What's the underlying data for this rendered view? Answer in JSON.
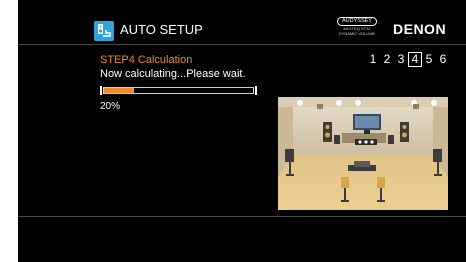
{
  "header": {
    "title": "AUTO SETUP",
    "brand": "DENON",
    "audyssey": {
      "badge": "AUDYSSEY",
      "line1": "MULTEQ XT32",
      "line2": "DYNAMIC VOLUME"
    }
  },
  "step": {
    "title": "STEP4 Calculation",
    "message": "Now calculating...Please wait.",
    "progress_label": "20%",
    "progress": 0.2
  },
  "steps": {
    "numbers": [
      "1",
      "2",
      "3",
      "4",
      "5",
      "6"
    ],
    "current": "4"
  },
  "colors": {
    "accent": "#f08a2a",
    "background": "#000000",
    "text": "#ffffff",
    "app_icon": "#2aa6d8"
  },
  "icons": {
    "app": "auto-setup-icon"
  }
}
